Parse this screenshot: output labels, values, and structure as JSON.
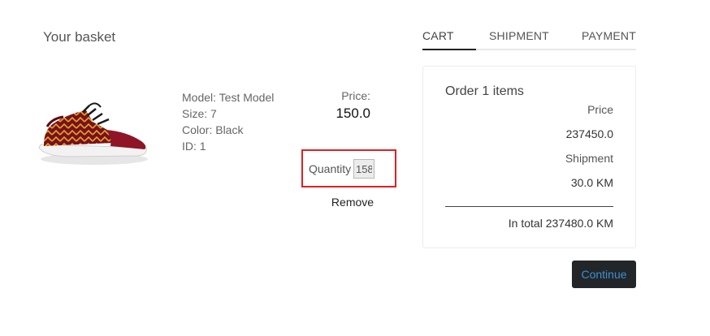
{
  "basket": {
    "title": "Your basket"
  },
  "product": {
    "image_icon": "sneaker-image",
    "model": "Model: Test Model",
    "size": "Size: 7",
    "color": "Color: Black",
    "id": "ID: 1",
    "price_label": "Price:",
    "price_value": "150.0",
    "quantity_label": "Quantity",
    "quantity_value": "158",
    "remove_label": "Remove"
  },
  "tabs": [
    {
      "label": "CART",
      "active": true
    },
    {
      "label": "SHIPMENT",
      "active": false
    },
    {
      "label": "PAYMENT",
      "active": false
    }
  ],
  "order": {
    "title": "Order 1 items",
    "price_label": "Price",
    "price_value": "237450.0",
    "shipment_label": "Shipment",
    "shipment_value": "30.0 KM",
    "total": "In total 237480.0 KM"
  },
  "actions": {
    "continue_label": "Continue"
  },
  "colors": {
    "highlight_border": "#e02020",
    "button_background": "#222629",
    "button_text": "#3d8fd1"
  }
}
